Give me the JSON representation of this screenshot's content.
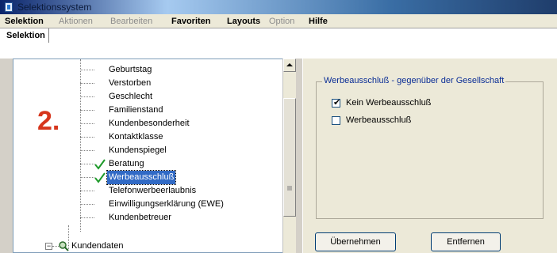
{
  "window": {
    "title": "Selektionssystem"
  },
  "menu": {
    "items": [
      {
        "label": "Selektion",
        "enabled": true
      },
      {
        "label": "Aktionen",
        "enabled": false
      },
      {
        "label": "Bearbeiten",
        "enabled": false
      },
      {
        "label": "Favoriten",
        "enabled": true
      },
      {
        "label": "Layouts",
        "enabled": true
      },
      {
        "label": "Option",
        "enabled": false
      },
      {
        "label": "Hilfe",
        "enabled": true
      }
    ]
  },
  "tabs": [
    {
      "label": "Selektion",
      "active": true
    }
  ],
  "step_label": "2.",
  "tree": {
    "items": [
      {
        "label": "Geburtstag",
        "checked": false,
        "selected": false
      },
      {
        "label": "Verstorben",
        "checked": false,
        "selected": false
      },
      {
        "label": "Geschlecht",
        "checked": false,
        "selected": false
      },
      {
        "label": "Familienstand",
        "checked": false,
        "selected": false
      },
      {
        "label": "Kundenbesonderheit",
        "checked": false,
        "selected": false
      },
      {
        "label": "Kontaktklasse",
        "checked": false,
        "selected": false
      },
      {
        "label": "Kundenspiegel",
        "checked": false,
        "selected": false
      },
      {
        "label": "Beratung",
        "checked": true,
        "selected": false
      },
      {
        "label": "Werbeausschluß",
        "checked": true,
        "selected": true
      },
      {
        "label": "Telefonwerbeerlaubnis",
        "checked": false,
        "selected": false
      },
      {
        "label": "Einwilligungserklärung (EWE)",
        "checked": false,
        "selected": false
      },
      {
        "label": "Kundenbetreuer",
        "checked": false,
        "selected": false
      }
    ],
    "parent_node": {
      "label": "Kundendaten",
      "icon": "magnifier-icon",
      "expander": "−"
    }
  },
  "right_panel": {
    "group_title": "Werbeausschluß - gegenüber der Gesellschaft",
    "options": [
      {
        "label": "Kein Werbeausschluß",
        "checked": true
      },
      {
        "label": "Werbeausschluß",
        "checked": false
      }
    ],
    "buttons": {
      "apply": "Übernehmen",
      "remove": "Entfernen"
    }
  },
  "colors": {
    "check": "#1e9a2a",
    "selection": "#316ac5",
    "step_label": "#d6361d",
    "group_title": "#0b2e96"
  }
}
